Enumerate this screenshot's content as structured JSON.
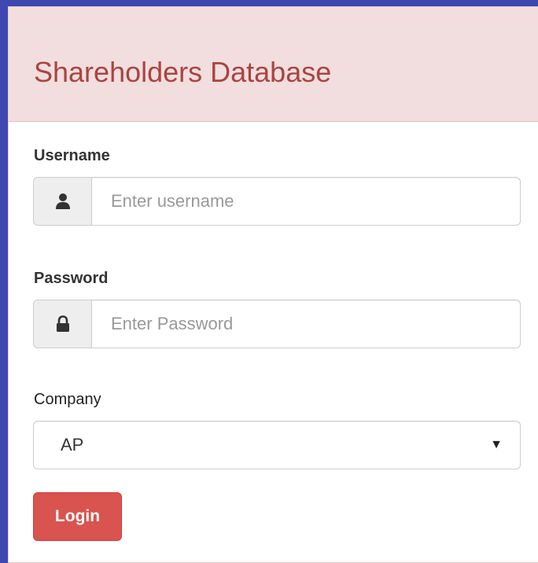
{
  "header": {
    "title": "Shareholders Database"
  },
  "form": {
    "username": {
      "label": "Username",
      "placeholder": "Enter username",
      "value": "",
      "icon": "user-icon"
    },
    "password": {
      "label": "Password",
      "placeholder": "Enter Password",
      "value": "",
      "icon": "lock-icon"
    },
    "company": {
      "label": "Company",
      "selected": "AP"
    },
    "login_label": "Login"
  },
  "colors": {
    "background": "#3f48b0",
    "heading_bg": "#f2dede",
    "heading_text": "#a94442",
    "button_bg": "#d9534f"
  }
}
